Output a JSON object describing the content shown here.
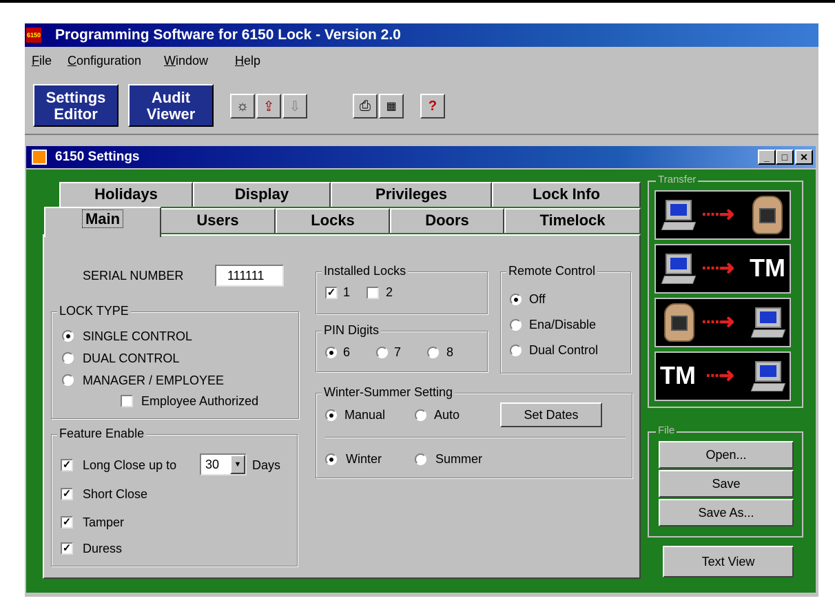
{
  "app": {
    "title": "Programming Software for 6150 Lock - Version 2.0",
    "icon_text": "6150"
  },
  "menu": {
    "items": [
      "File",
      "Configuration",
      "Window",
      "Help"
    ]
  },
  "toolbar": {
    "settings_editor": [
      "Settings",
      "Editor"
    ],
    "audit_viewer": [
      "Audit",
      "Viewer"
    ],
    "icons": [
      "new-document-icon",
      "upload-icon",
      "download-icon",
      "printer-icon",
      "print-preview-icon",
      "help-icon"
    ]
  },
  "child_window": {
    "title": "6150 Settings"
  },
  "tabs": {
    "row1": [
      "Holidays",
      "Display",
      "Privileges",
      "Lock Info"
    ],
    "row2": [
      "Main",
      "Users",
      "Locks",
      "Doors",
      "Timelock"
    ],
    "active": "Main"
  },
  "main": {
    "serial_label": "SERIAL NUMBER",
    "serial_value": "111111",
    "lock_type": {
      "label": "LOCK TYPE",
      "options": [
        "SINGLE CONTROL",
        "DUAL CONTROL",
        "MANAGER / EMPLOYEE"
      ],
      "selected": "SINGLE CONTROL",
      "employee_authorized": "Employee Authorized"
    },
    "feature_enable": {
      "label": "Feature Enable",
      "long_close_prefix": "Long Close up to",
      "long_close_value": "30",
      "long_close_suffix": "Days",
      "short_close": "Short Close",
      "tamper": "Tamper",
      "duress": "Duress"
    },
    "installed_locks": {
      "label": "Installed Locks",
      "lock1": "1",
      "lock2": "2"
    },
    "pin_digits": {
      "label": "PIN Digits",
      "options": [
        "6",
        "7",
        "8"
      ],
      "selected": "6"
    },
    "remote_control": {
      "label": "Remote Control",
      "options": [
        "Off",
        "Ena/Disable",
        "Dual Control"
      ],
      "selected": "Off"
    },
    "winter_summer": {
      "label": "Winter-Summer Setting",
      "mode_options": [
        "Manual",
        "Auto"
      ],
      "mode_selected": "Manual",
      "set_dates": "Set Dates",
      "season_options": [
        "Winter",
        "Summer"
      ],
      "season_selected": "Winter"
    }
  },
  "transfer": {
    "label": "Transfer",
    "tm": "TM"
  },
  "file_group": {
    "label": "File",
    "open": "Open...",
    "save": "Save",
    "save_as": "Save As..."
  },
  "text_view": "Text View",
  "colors": {
    "title_blue": "#000080",
    "green_frame": "#1e7d1e",
    "button_blue": "#1f2f8e"
  }
}
